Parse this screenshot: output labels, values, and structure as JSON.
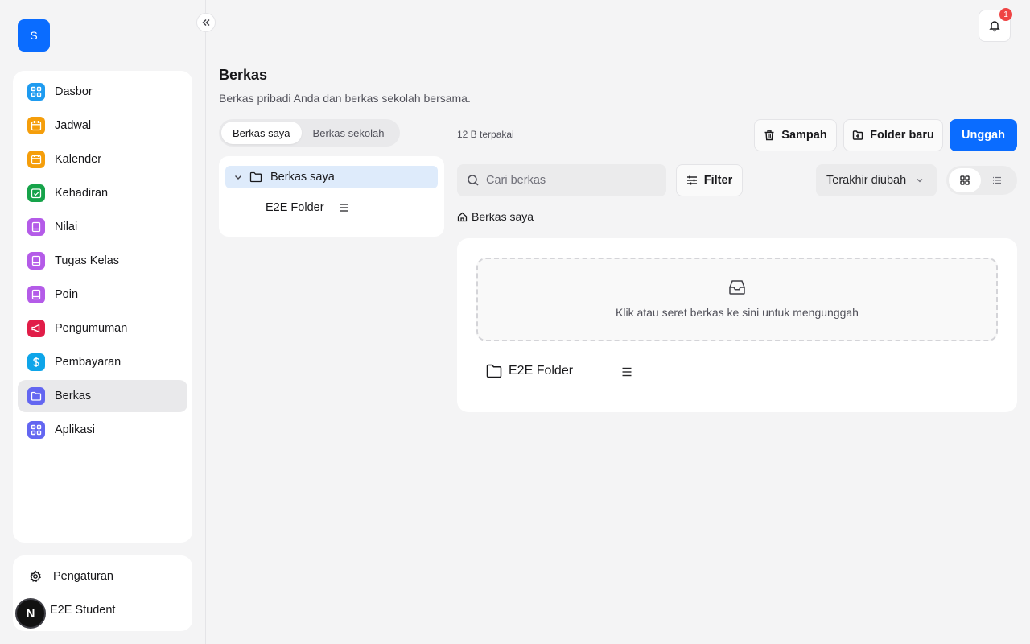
{
  "sidebar": {
    "logo_letter": "S",
    "items": [
      {
        "label": "Dasbor",
        "color": "#1e9bf0"
      },
      {
        "label": "Jadwal",
        "color": "#f59e0b"
      },
      {
        "label": "Kalender",
        "color": "#f59e0b"
      },
      {
        "label": "Kehadiran",
        "color": "#16a34a"
      },
      {
        "label": "Nilai",
        "color": "#b45be8"
      },
      {
        "label": "Tugas Kelas",
        "color": "#b45be8"
      },
      {
        "label": "Poin",
        "color": "#b45be8"
      },
      {
        "label": "Pengumuman",
        "color": "#e11d48"
      },
      {
        "label": "Pembayaran",
        "color": "#0ea5e9"
      },
      {
        "label": "Berkas",
        "color": "#6366f1",
        "active": true
      },
      {
        "label": "Aplikasi",
        "color": "#6366f1"
      }
    ],
    "settings_label": "Pengaturan",
    "user_name": "E2E Student",
    "user_initial": "N"
  },
  "topbar": {
    "notification_count": "1"
  },
  "page": {
    "title": "Berkas",
    "subtitle": "Berkas pribadi Anda dan berkas sekolah bersama."
  },
  "tabs": [
    {
      "label": "Berkas saya",
      "active": true
    },
    {
      "label": "Berkas sekolah",
      "active": false
    }
  ],
  "tree": {
    "root_label": "Berkas saya",
    "children": [
      "E2E Folder"
    ]
  },
  "toolbar": {
    "usage": "12 B terpakai",
    "trash_label": "Sampah",
    "new_folder_label": "Folder baru",
    "upload_label": "Unggah",
    "search_placeholder": "Cari berkas",
    "filter_label": "Filter",
    "sort_label": "Terakhir diubah"
  },
  "breadcrumb": {
    "root": "Berkas saya"
  },
  "files": {
    "dropzone_text": "Klik atau seret berkas ke sini untuk mengunggah",
    "items": [
      {
        "name": "E2E Folder",
        "type": "folder"
      }
    ]
  },
  "colors": {
    "primary": "#0a6cff",
    "active_tree": "#deebfb",
    "badge": "#ef4444"
  }
}
